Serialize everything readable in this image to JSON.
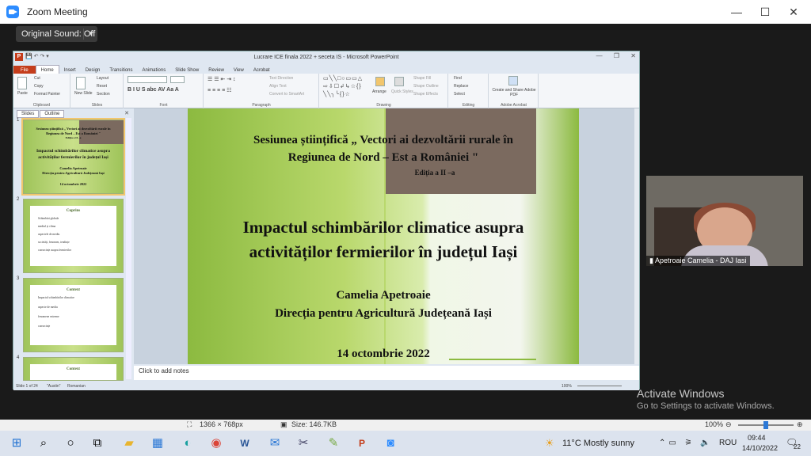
{
  "zoom": {
    "title": "Zoom Meeting",
    "original_sound": "Original Sound: Off"
  },
  "ppt": {
    "title": "Lucrare ICE finala 2022 + seceta IS  -  Microsoft PowerPoint",
    "tabs": [
      "File",
      "Home",
      "Insert",
      "Design",
      "Transitions",
      "Animations",
      "Slide Show",
      "Review",
      "View",
      "Acrobat"
    ],
    "ribbon": {
      "paste": "Paste",
      "cut": "Cut",
      "copy": "Copy",
      "format_painter": "Format Painter",
      "clipboard": "Clipboard",
      "new_slide": "New Slide",
      "layout": "Layout",
      "reset": "Reset",
      "section": "Section",
      "slides": "Slides",
      "font": "Font",
      "paragraph": "Paragraph",
      "text_direction": "Text Direction",
      "align_text": "Align Text",
      "convert_smartart": "Convert to SmartArt",
      "drawing": "Drawing",
      "arrange": "Arrange",
      "quick_styles": "Quick Styles",
      "shape_fill": "Shape Fill",
      "shape_outline": "Shape Outline",
      "shape_effects": "Shape Effects",
      "find": "Find",
      "replace": "Replace",
      "select": "Select",
      "editing": "Editing",
      "create_pdf": "Create and Share Adobe PDF",
      "adobe_acrobat": "Adobe Acrobat"
    },
    "panel_tabs": [
      "Slides",
      "Outline"
    ],
    "thumbs": [
      {
        "num": "1",
        "lines": [
          "Sesiunea științifică „ Vectori ai dezvoltării rurale în",
          "Regiunea de Nord – Est a României \"",
          "Ediția a II –a",
          "Impactul schimbărilor climatice asupra",
          "activităților fermierilor în județul Iași",
          "Camelia Apetroaie",
          "Direcția pentru Agricultură Județeană Iași",
          "14 octombrie 2022"
        ]
      },
      {
        "num": "2",
        "title": "Cuprins",
        "items": [
          "Schimbări globale",
          "mediul și clima",
          "aspectele de mediu",
          "societăți, fenomen, tendințe",
          "consecințe asupra fermierilor"
        ]
      },
      {
        "num": "3",
        "title": "Context",
        "items": [
          "Impactul schimbărilor climatice",
          "aspecte de mediu",
          "fenomene extreme",
          "consecințe"
        ]
      },
      {
        "num": "4",
        "title": "Context",
        "items": []
      }
    ],
    "slide": {
      "session": "Sesiunea științifică „ Vectori ai dezvoltării rurale în",
      "region": "Regiunea de Nord – Est a României \"",
      "edition": "Ediția a II –a",
      "title1": "Impactul schimbărilor climatice asupra",
      "title2": "activităților  fermierilor în județul Iași",
      "author": "Camelia Apetroaie",
      "org": "Direcția pentru Agricultură Județeană Iași",
      "date": "14 octombrie 2022"
    },
    "notes_placeholder": "Click to add notes",
    "status": {
      "slide": "Slide 1 of 24",
      "theme": "\"Austin\"",
      "lang": "Romanian",
      "zoom": "100%"
    }
  },
  "participant": {
    "name": "Apetroaie Camelia - DAJ Iasi"
  },
  "watermark": {
    "line1": "Activate Windows",
    "line2": "Go to Settings to activate Windows."
  },
  "viewer": {
    "dimensions": "1366 × 768px",
    "size": "Size: 146.7KB",
    "zoom": "100%"
  },
  "taskbar": {
    "weather": "11°C  Mostly sunny",
    "lang": "ROU",
    "time": "09:44",
    "date": "14/10/2022",
    "notif": "22"
  }
}
